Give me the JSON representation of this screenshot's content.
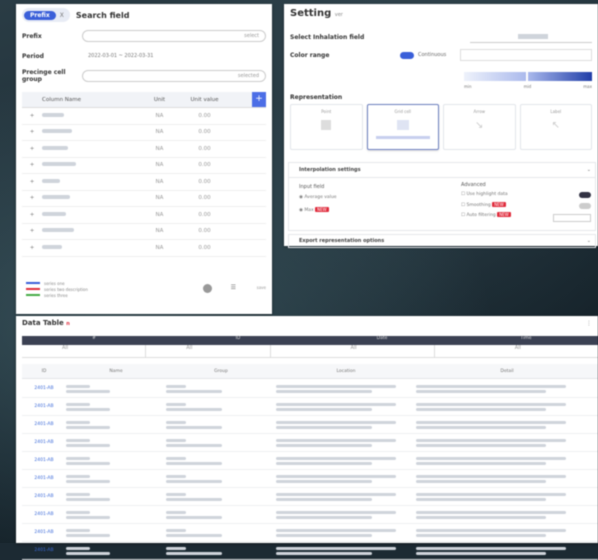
{
  "left_panel": {
    "mode_on": "Prefix",
    "mode_off": "X",
    "title": "Search field",
    "fields": [
      {
        "label": "Prefix",
        "value": "select"
      },
      {
        "label": "Period",
        "value": "2022-03-01  ~  2022-03-31"
      },
      {
        "label": "Precinge cell group",
        "value": "selected"
      }
    ],
    "table": {
      "headers": [
        "",
        "Column Name",
        "Unit",
        "Unit value"
      ],
      "add_label": "+",
      "rows": [
        {
          "idx": "+",
          "unit": "NA",
          "value": "0.00"
        },
        {
          "idx": "+",
          "unit": "NA",
          "value": "0.00"
        },
        {
          "idx": "+",
          "unit": "NA",
          "value": "0.00"
        },
        {
          "idx": "+",
          "unit": "NA",
          "value": "0.00"
        },
        {
          "idx": "+",
          "unit": "NA",
          "value": "0.00"
        },
        {
          "idx": "+",
          "unit": "NA",
          "value": "0.00"
        },
        {
          "idx": "+",
          "unit": "NA",
          "value": "0.00"
        },
        {
          "idx": "+",
          "unit": "NA",
          "value": "0.00"
        },
        {
          "idx": "+",
          "unit": "NA",
          "value": "0.00"
        }
      ]
    },
    "footer_legend": [
      "series one",
      "series two description",
      "series three"
    ],
    "footer_buttons": [
      "reset",
      "list",
      "save"
    ]
  },
  "right_panel": {
    "title": "Setting",
    "title_tag": "ver",
    "section1": "Select Inhalation field",
    "section2": "Color range",
    "section2_toggle": "Continuous",
    "gradient_ticks": [
      "min",
      "mid",
      "max"
    ],
    "section3": "Representation",
    "cards": [
      "Point",
      "Grid cell",
      "Arrow",
      "Label"
    ],
    "accordion1": "Interpolation settings",
    "box_left_title": "Input field",
    "box_left_items": [
      "Average value",
      "Max"
    ],
    "box_right_title": "Advanced",
    "box_right_items": [
      "Use highlight data",
      "Smoothing",
      "Auto filtering"
    ],
    "accordion2": "Export representation options",
    "colors": {
      "accent": "#3a5fd9",
      "chip": "#e02b3c",
      "gradient_end": "#203ea8"
    }
  },
  "bottom_panel": {
    "title": "Data Table",
    "title_badge": "n",
    "head": [
      "#",
      "ID",
      "Date",
      "Time"
    ],
    "filter": [
      "All",
      "All",
      "All",
      "All"
    ],
    "columns": [
      "ID",
      "Name",
      "Group",
      "Location",
      "Detail"
    ],
    "rows": [
      {
        "id": "2401-AB"
      },
      {
        "id": "2401-AB"
      },
      {
        "id": "2401-AB"
      },
      {
        "id": "2401-AB"
      },
      {
        "id": "2401-AB"
      },
      {
        "id": "2401-AB"
      },
      {
        "id": "2401-AB"
      },
      {
        "id": "2401-AB"
      },
      {
        "id": "2401-AB"
      },
      {
        "id": "2401-AB"
      }
    ]
  }
}
